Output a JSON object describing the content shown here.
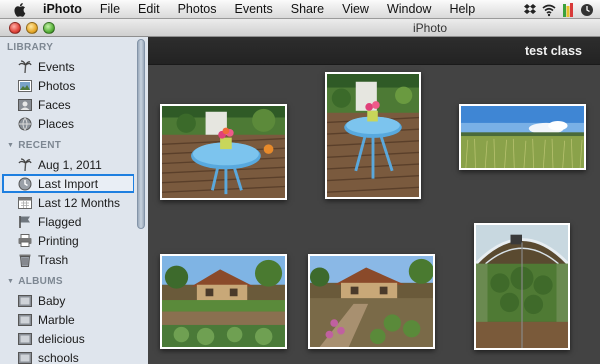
{
  "menubar": {
    "app_name": "iPhoto",
    "items": [
      "File",
      "Edit",
      "Photos",
      "Events",
      "Share",
      "View",
      "Window",
      "Help"
    ],
    "tray_icons": [
      "dropbox-icon",
      "wifi-icon",
      "battery-meter-icon",
      "clock-icon"
    ]
  },
  "window": {
    "title": "iPhoto"
  },
  "sidebar": {
    "library": {
      "header": "LIBRARY",
      "items": [
        {
          "label": "Events",
          "icon": "palm-tree-icon"
        },
        {
          "label": "Photos",
          "icon": "photo-icon"
        },
        {
          "label": "Faces",
          "icon": "faces-icon"
        },
        {
          "label": "Places",
          "icon": "globe-icon"
        }
      ]
    },
    "recent": {
      "header": "RECENT",
      "items": [
        {
          "label": "Aug 1, 2011",
          "icon": "palm-tree-icon"
        },
        {
          "label": "Last Import",
          "icon": "clock-icon",
          "selected": true
        },
        {
          "label": "Last 12 Months",
          "icon": "calendar-icon"
        },
        {
          "label": "Flagged",
          "icon": "flag-icon"
        },
        {
          "label": "Printing",
          "icon": "printer-icon"
        },
        {
          "label": "Trash",
          "icon": "trash-icon"
        }
      ]
    },
    "albums": {
      "header": "ALBUMS",
      "items": [
        {
          "label": "Baby",
          "icon": "album-icon"
        },
        {
          "label": "Marble",
          "icon": "album-icon"
        },
        {
          "label": "delicious",
          "icon": "album-icon"
        },
        {
          "label": "schools",
          "icon": "album-icon"
        }
      ]
    }
  },
  "main": {
    "event_title": "test class",
    "photos": [
      {
        "subject": "patio-table-with-flowers",
        "scene": "patio1"
      },
      {
        "subject": "patio-table-with-flowers-portrait",
        "scene": "patio2"
      },
      {
        "subject": "wheat-field",
        "scene": "field"
      },
      {
        "subject": "garden-house",
        "scene": "house1"
      },
      {
        "subject": "garden-house-flowers",
        "scene": "house2"
      },
      {
        "subject": "greenhouse-interior",
        "scene": "greenhouse"
      }
    ]
  },
  "colors": {
    "selection_outline": "#1e7fe0",
    "sidebar_bg": "#dfe5ed",
    "main_bg": "#434343"
  }
}
